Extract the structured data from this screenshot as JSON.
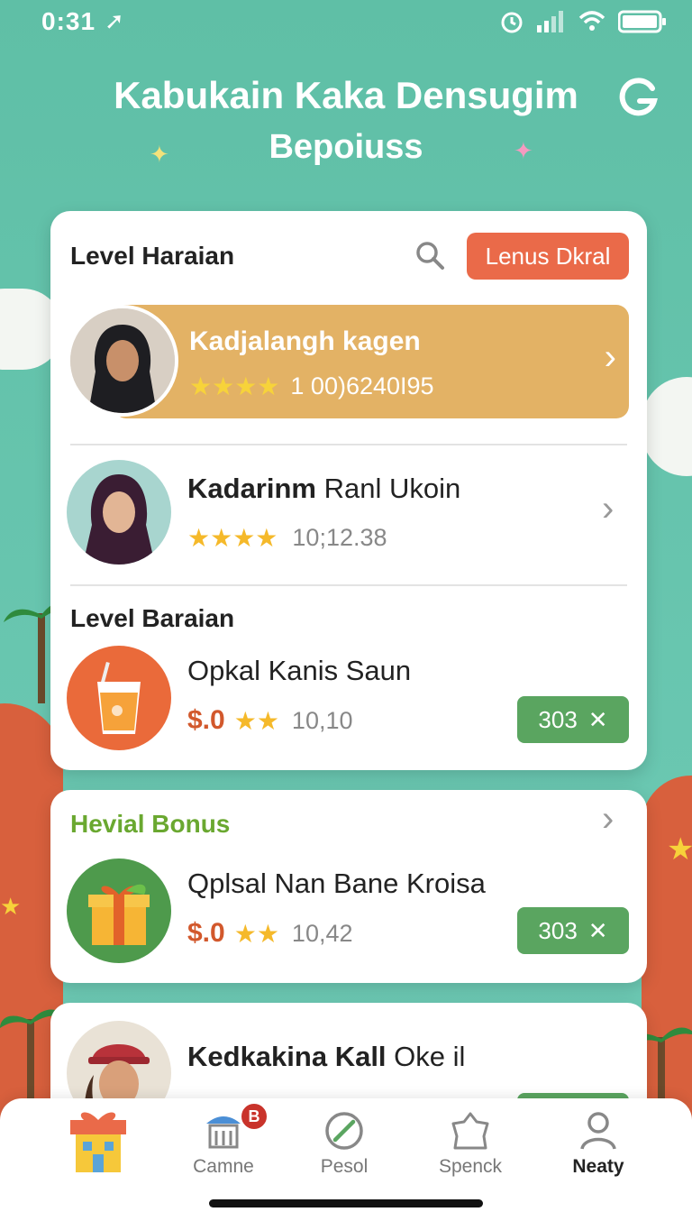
{
  "status": {
    "time": "0:31"
  },
  "header": {
    "title_line1": "Kabukain Kaka Densugim",
    "title_line2": "Bepoiuss"
  },
  "card1": {
    "section_label": "Level Haraian",
    "action_button": "Lenus Dkral",
    "rows": [
      {
        "name": "Kadjalangh kagen",
        "rating_text": "1 00)6240I95",
        "stars": 4,
        "highlighted": true
      },
      {
        "name_bold": "Kadarinm",
        "name_rest": " Ranl Ukoin",
        "rating_text": "10;12.38",
        "stars": 4
      }
    ],
    "section2_label": "Level Baraian",
    "product": {
      "name": "Opkal Kanis Saun",
      "price": "$.0",
      "rating_text": "10,10",
      "stars": 2,
      "pill": "303"
    }
  },
  "card2": {
    "section_label": "Hevial Bonus",
    "product": {
      "name": "Qplsal Nan Bane Kroisa",
      "price": "$.0",
      "rating_text": "10,42",
      "stars": 2,
      "pill": "303"
    }
  },
  "card3": {
    "name_bold": "Kedkakina Kall",
    "name_rest": " Oke il"
  },
  "nav": {
    "items": [
      {
        "label": "",
        "icon": "gift-house-icon"
      },
      {
        "label": "Camne",
        "icon": "shop-icon",
        "badge": "B"
      },
      {
        "label": "Pesol",
        "icon": "compass-icon"
      },
      {
        "label": "Spenck",
        "icon": "shape-icon"
      },
      {
        "label": "Neaty",
        "icon": "profile-icon",
        "active": true
      }
    ]
  },
  "colors": {
    "accent": "#ea6a49",
    "highlight_row": "#e3b265",
    "green": "#5aa560",
    "bonus_label": "#6aa830",
    "sky": "#5fbfa6"
  }
}
